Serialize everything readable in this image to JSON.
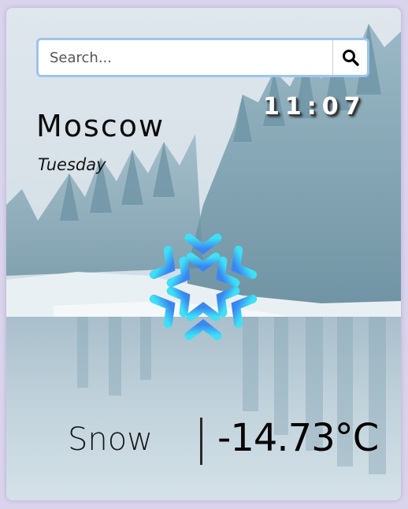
{
  "search": {
    "placeholder": "Search..."
  },
  "weather": {
    "time": "11:07",
    "city": "Moscow",
    "day": "Tuesday",
    "condition": "Snow",
    "temperature": "-14.73°C",
    "icon": "snowflake-icon"
  },
  "colors": {
    "page_bg": "#d9d3ec",
    "search_border": "#9cc4ee",
    "icon_top": "#3fe0f5",
    "icon_bottom": "#3a86f0"
  }
}
